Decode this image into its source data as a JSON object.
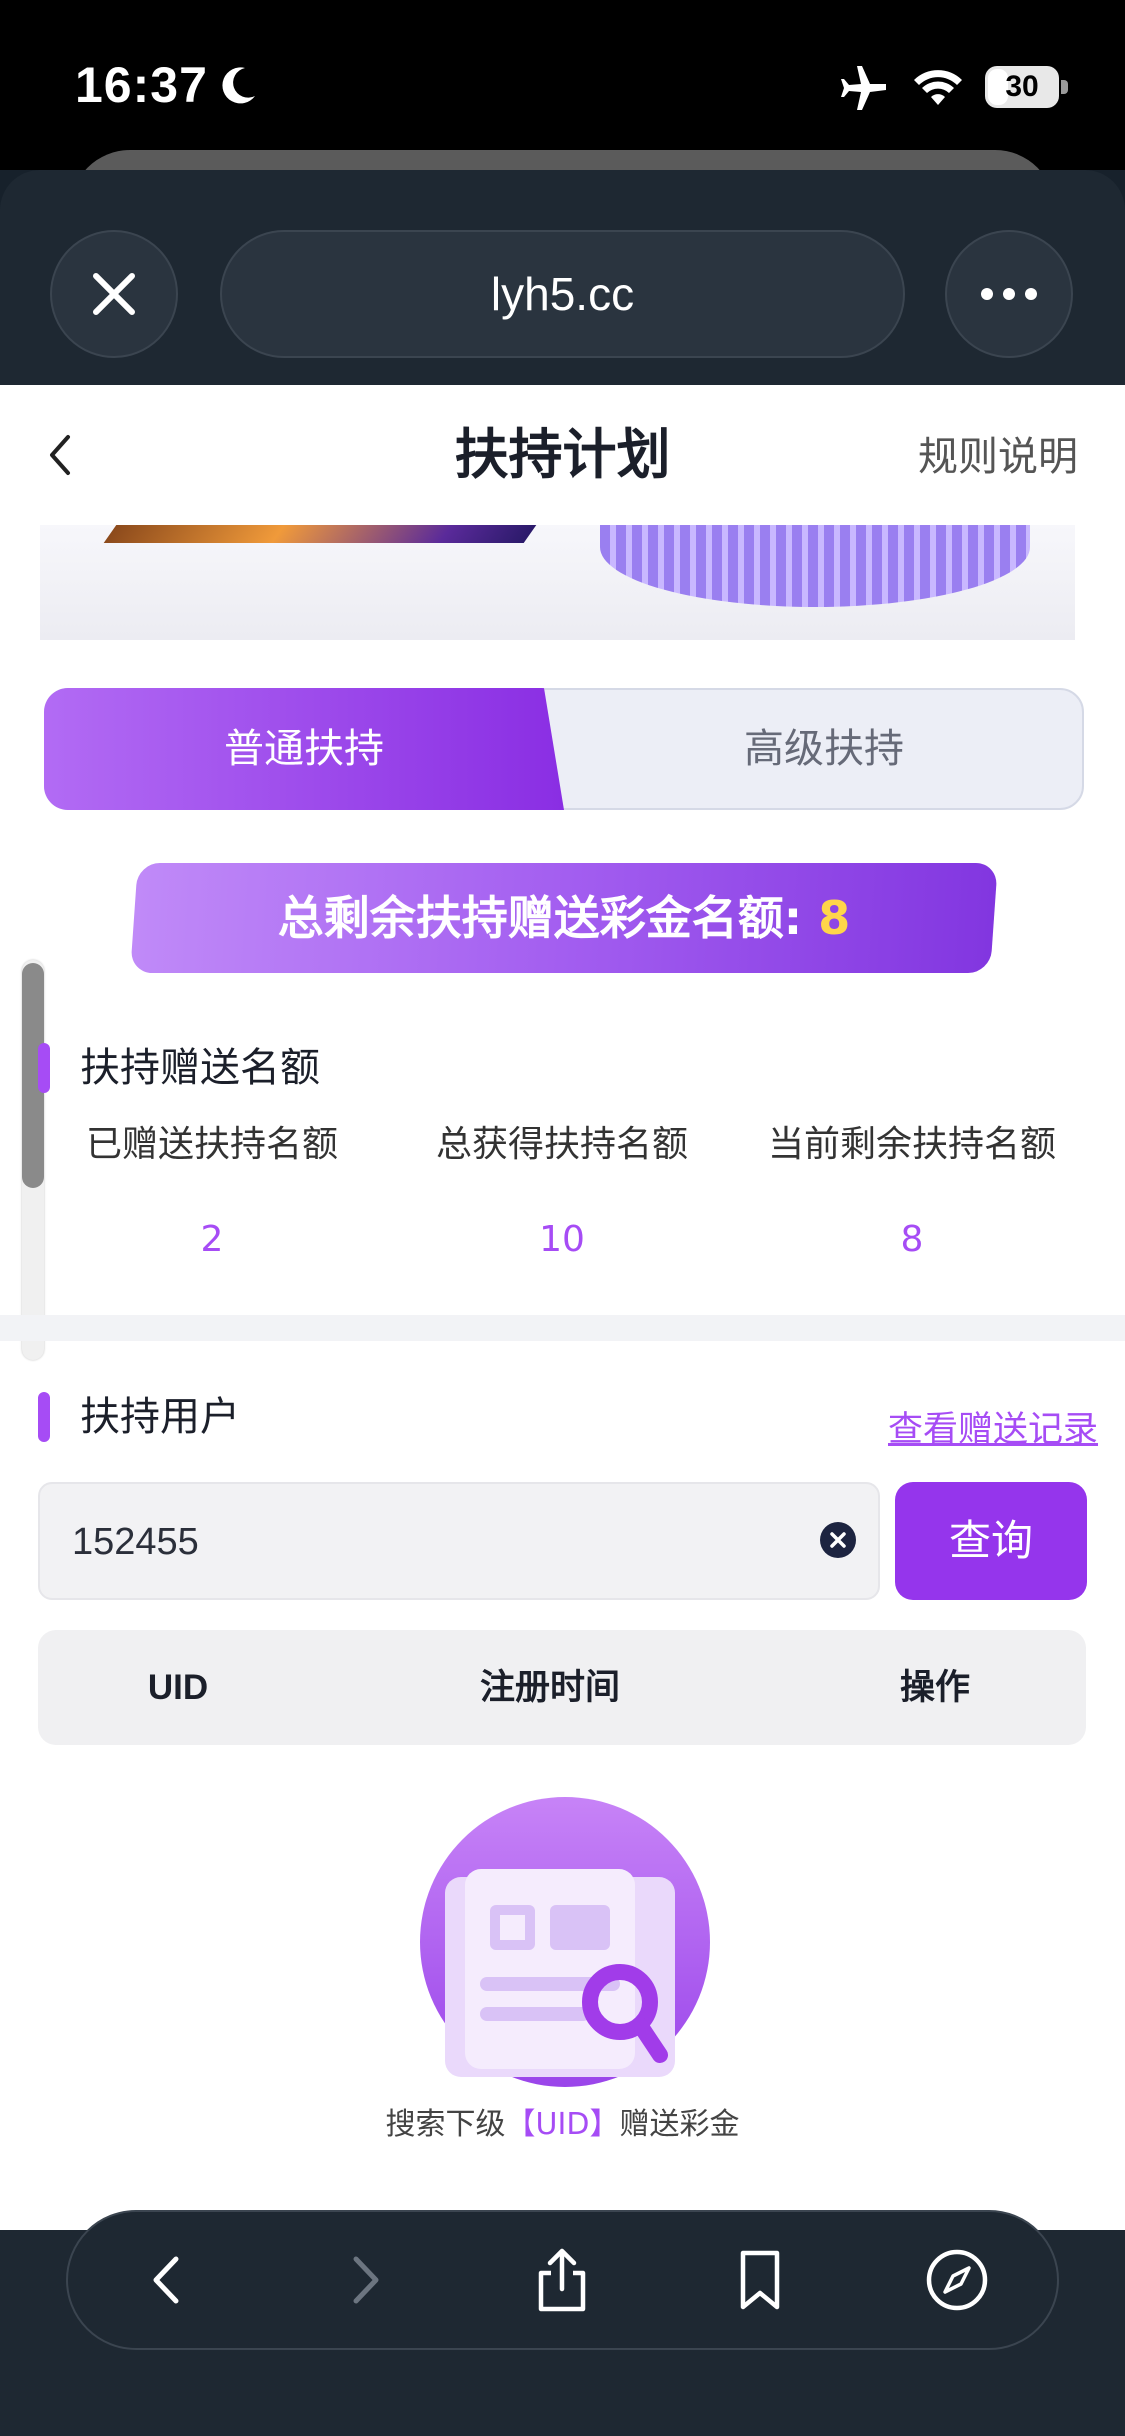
{
  "status_bar": {
    "time": "16:37",
    "battery": "30",
    "battery_level": 0.3
  },
  "browser": {
    "url": "lyh5.cc",
    "close_icon": "close-icon",
    "more_icon": "more-icon"
  },
  "nav": {
    "title": "扶持计划",
    "rules": "规则说明",
    "back_icon": "chevron-left-icon"
  },
  "tabs": [
    {
      "label": "普通扶持",
      "active": true
    },
    {
      "label": "高级扶持",
      "active": false
    }
  ],
  "total": {
    "label": "总剩余扶持赠送彩金名额: ",
    "value": "8"
  },
  "quota_section": {
    "title": "扶持赠送名额",
    "stats": [
      {
        "label": "已赠送扶持名额",
        "value": "2"
      },
      {
        "label": "总获得扶持名额",
        "value": "10"
      },
      {
        "label": "当前剩余扶持名额",
        "value": "8"
      }
    ]
  },
  "user_section": {
    "title": "扶持用户",
    "record_link": "查看赠送记录",
    "search_value": "152455",
    "query_button": "查询",
    "columns": [
      "UID",
      "注册时间",
      "操作"
    ]
  },
  "empty": {
    "prefix": "搜索下级",
    "highlight": "【UID】",
    "suffix": "赠送彩金"
  },
  "colors": {
    "accent": "#a64cf5",
    "button": "#9535ec",
    "highlight_number": "#ffd54a",
    "chrome": "#1e2832"
  }
}
